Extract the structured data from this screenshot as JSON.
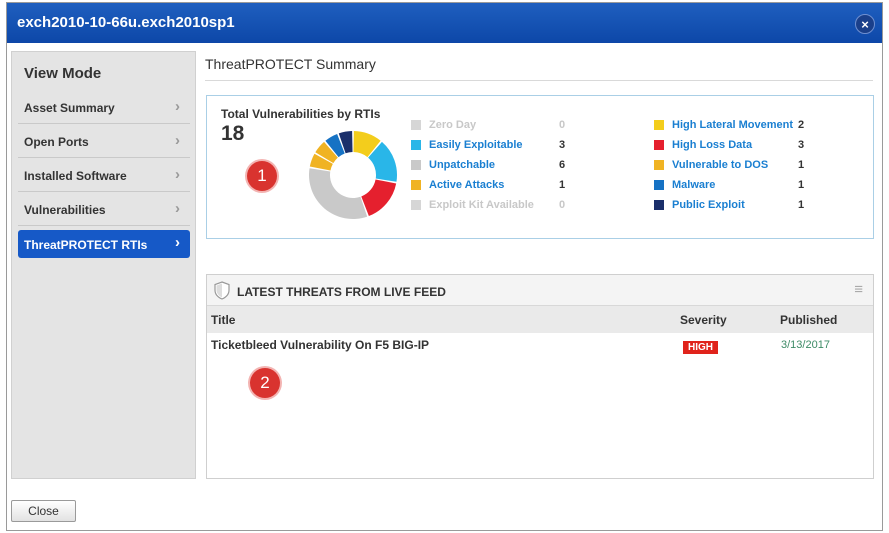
{
  "window": {
    "title": "exch2010-10-66u.exch2010sp1",
    "close_icon": "×"
  },
  "sidebar": {
    "heading": "View Mode",
    "items": [
      {
        "label": "Asset Summary",
        "active": false
      },
      {
        "label": "Open Ports",
        "active": false
      },
      {
        "label": "Installed Software",
        "active": false
      },
      {
        "label": "Vulnerabilities",
        "active": false
      },
      {
        "label": "ThreatPROTECT RTIs",
        "active": true
      }
    ],
    "chevron": "›"
  },
  "main": {
    "title": "ThreatPROTECT Summary"
  },
  "summary": {
    "heading": "Total Vulnerabilities by RTIs",
    "total": "18",
    "legend_left": [
      {
        "label": "Zero Day",
        "count": "0",
        "color": "#d6d6d6",
        "enabled": false
      },
      {
        "label": "Easily Exploitable",
        "count": "3",
        "color": "#29b6e8",
        "enabled": true
      },
      {
        "label": "Unpatchable",
        "count": "6",
        "color": "#c9c9c9",
        "enabled": true
      },
      {
        "label": "Active Attacks",
        "count": "1",
        "color": "#f0b323",
        "enabled": true
      },
      {
        "label": "Exploit Kit Available",
        "count": "0",
        "color": "#d6d6d6",
        "enabled": false
      }
    ],
    "legend_right": [
      {
        "label": "High Lateral Movement",
        "count": "2",
        "color": "#f3cd1c",
        "enabled": true
      },
      {
        "label": "High Loss Data",
        "count": "3",
        "color": "#e5202e",
        "enabled": true
      },
      {
        "label": "Vulnerable to DOS",
        "count": "1",
        "color": "#f0b323",
        "enabled": true
      },
      {
        "label": "Malware",
        "count": "1",
        "color": "#1672c4",
        "enabled": true
      },
      {
        "label": "Public Exploit",
        "count": "1",
        "color": "#1a2f6b",
        "enabled": true
      }
    ]
  },
  "chart_data": {
    "type": "pie",
    "categories": [
      "High Lateral Movement",
      "Easily Exploitable",
      "High Loss Data",
      "Unpatchable",
      "Active Attacks",
      "Vulnerable to DOS",
      "Malware",
      "Public Exploit"
    ],
    "values": [
      2,
      3,
      3,
      6,
      1,
      1,
      1,
      1
    ],
    "colors": [
      "#f3cd1c",
      "#29b6e8",
      "#e5202e",
      "#c9c9c9",
      "#f0b323",
      "#f0b323",
      "#1672c4",
      "#1a2f6b"
    ],
    "title": "Total Vulnerabilities by RTIs"
  },
  "callouts": {
    "one": "1",
    "two": "2"
  },
  "threats": {
    "heading": "LATEST THREATS FROM LIVE FEED",
    "menu_icon": "≡",
    "columns": {
      "title": "Title",
      "severity": "Severity",
      "published": "Published"
    },
    "rows": [
      {
        "title": "Ticketbleed Vulnerability On F5 BIG-IP",
        "severity": "HIGH",
        "published": "3/13/2017"
      }
    ]
  },
  "footer": {
    "close_label": "Close"
  }
}
